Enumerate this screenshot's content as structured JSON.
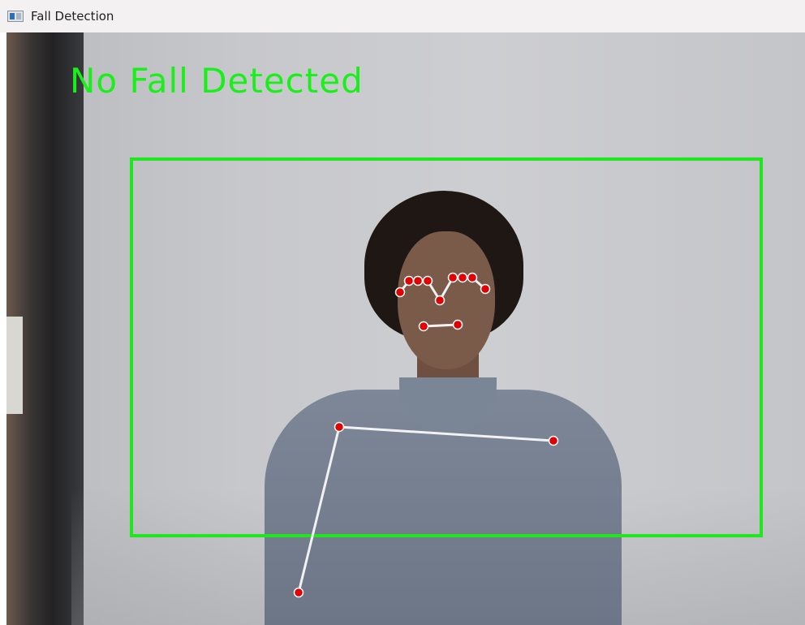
{
  "window": {
    "title": "Fall Detection",
    "icon": "app-window-icon"
  },
  "overlay": {
    "status": "No Fall Detected",
    "status_color": "#19f019",
    "bbox_color": "#1fe61f",
    "landmark_color": "#e00000",
    "skeleton_color": "#f2f2f2"
  }
}
